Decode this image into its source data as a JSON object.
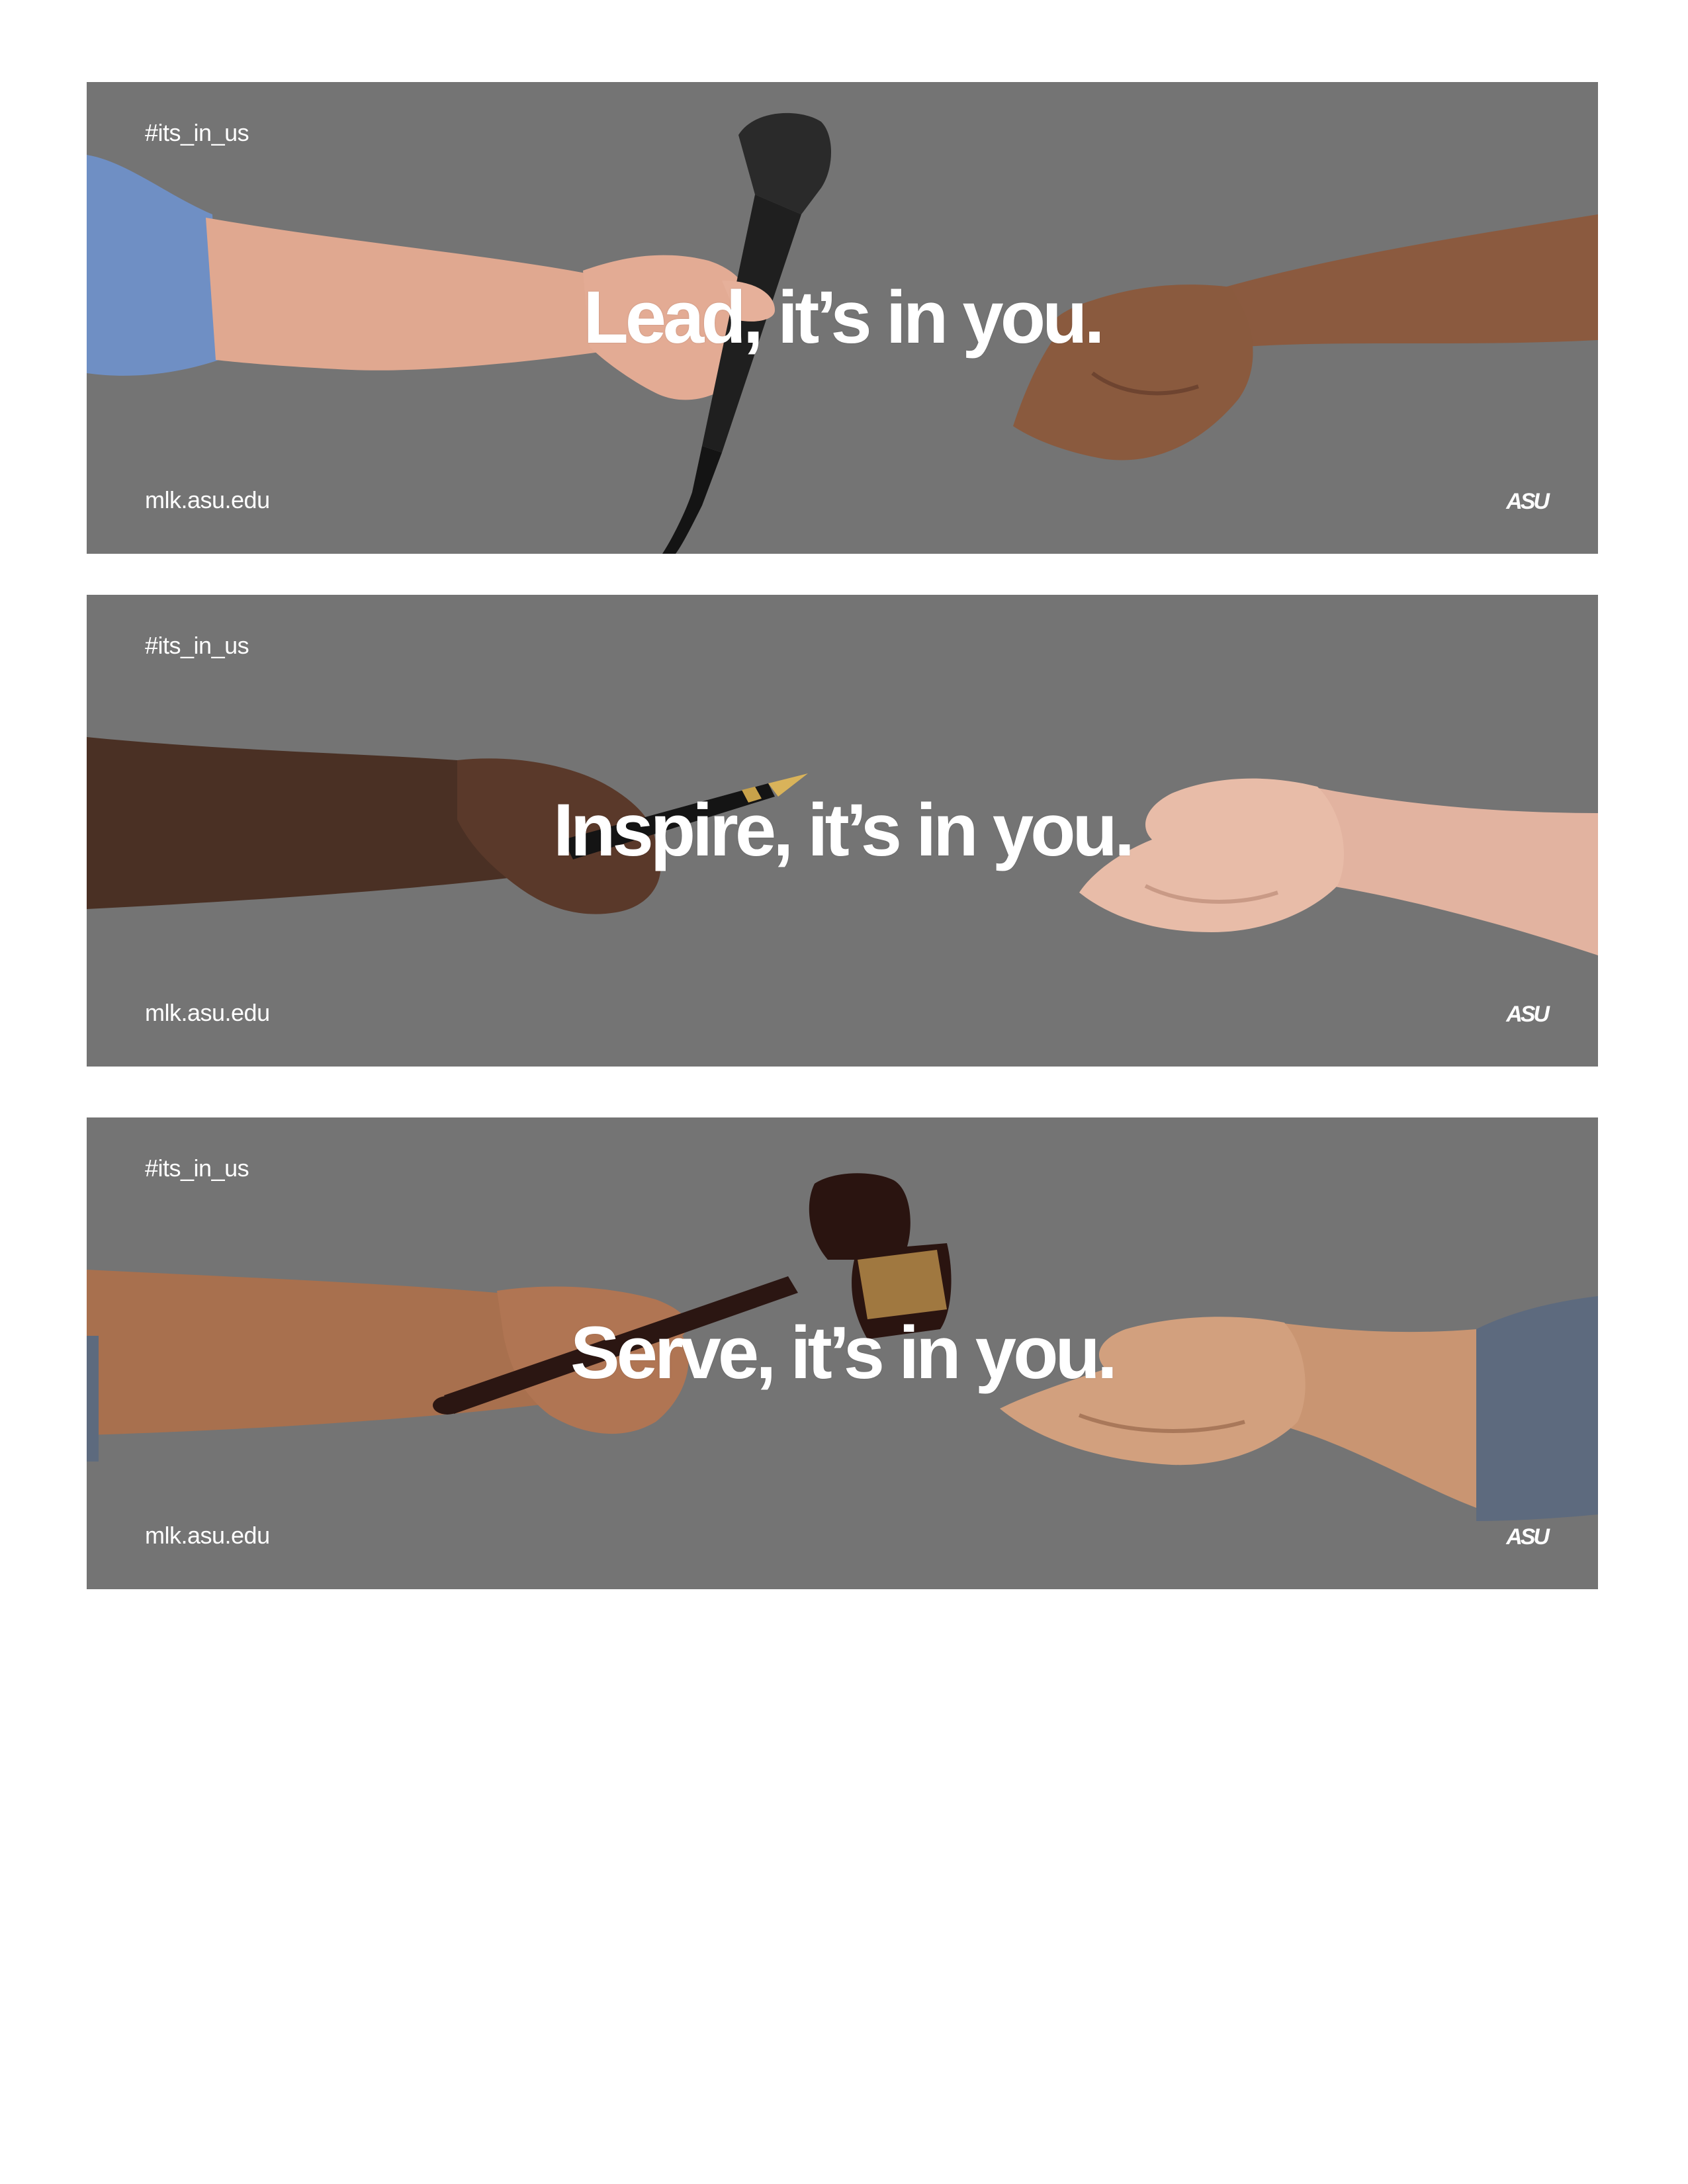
{
  "banners": [
    {
      "hashtag": "#its_in_us",
      "headline": "Lead, it’s in you.",
      "url": "mlk.asu.edu",
      "logo": "ASU",
      "object": "microphone"
    },
    {
      "hashtag": "#its_in_us",
      "headline": "Inspire, it’s in you.",
      "url": "mlk.asu.edu",
      "logo": "ASU",
      "object": "fountain-pen"
    },
    {
      "hashtag": "#its_in_us",
      "headline": "Serve, it’s in you.",
      "url": "mlk.asu.edu",
      "logo": "ASU",
      "object": "gavel"
    }
  ],
  "colors": {
    "banner_background": "#747474",
    "page_background": "#ffffff",
    "text": "#ffffff"
  }
}
